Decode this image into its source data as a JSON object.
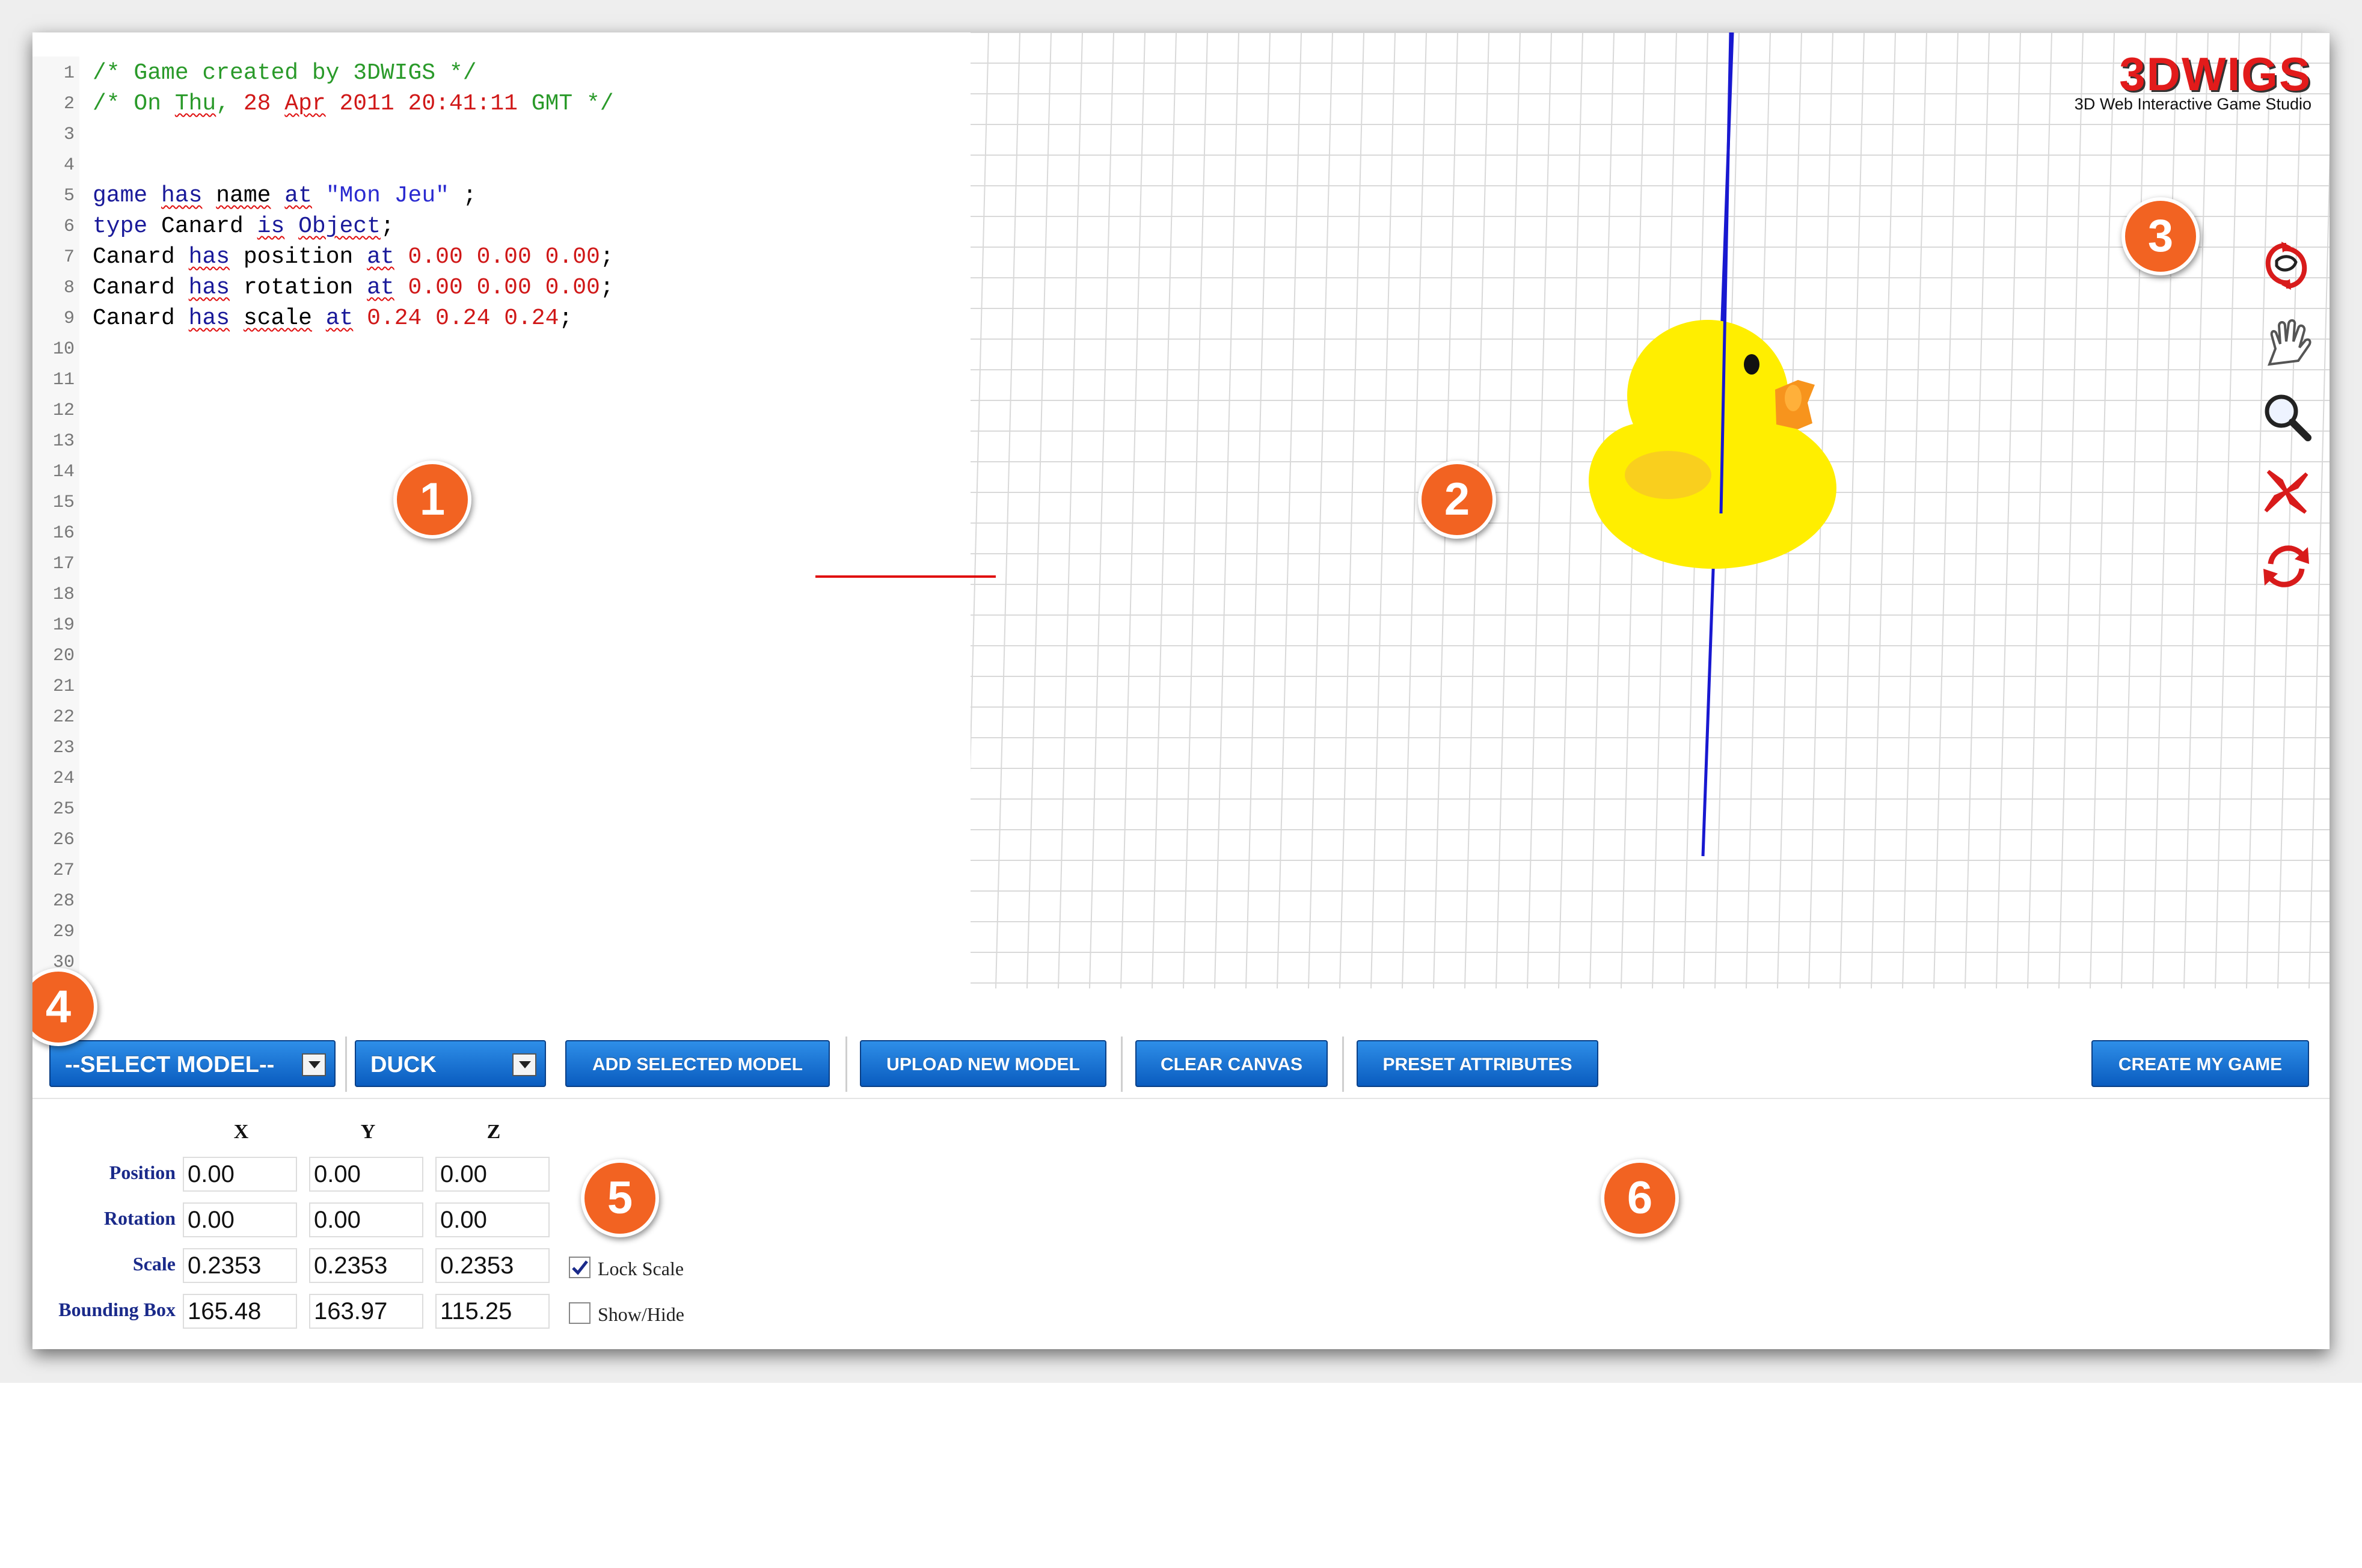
{
  "app": {
    "logo_text": "3DWIGS",
    "logo_tagline": "3D Web Interactive Game Studio"
  },
  "editor": {
    "line_numbers": [
      "1",
      "2",
      "3",
      "4",
      "5",
      "6",
      "7",
      "8",
      "9",
      "10",
      "11",
      "12",
      "13",
      "14",
      "15",
      "16",
      "17",
      "18",
      "19",
      "20",
      "21",
      "22",
      "23",
      "24",
      "25",
      "26",
      "27",
      "28",
      "29",
      "30"
    ],
    "lines": [
      "/* Game created by 3DWIGS */",
      "/* On Thu, 28 Apr 2011 20:41:11 GMT */",
      "",
      "",
      "game has name at \"Mon Jeu\" ;",
      "type Canard is Object;",
      "Canard has position at 0.00 0.00 0.00;",
      "Canard has rotation at 0.00 0.00 0.00;",
      "Canard has scale at 0.24 0.24 0.24;"
    ],
    "colors": {
      "comment": "#2a9a2a",
      "keyword": "#1a1a9a",
      "number": "#d01818",
      "string": "#2a2ad0",
      "date": "#d01818"
    }
  },
  "viewport": {
    "model": "duck",
    "colors": {
      "grid": "#d9d9d9",
      "x_axis": "#e01010",
      "y_axis": "#1818d0",
      "duck_body": "#ffee00",
      "duck_beak": "#f7941d"
    }
  },
  "view_tools": [
    {
      "name": "rotate-view-icon"
    },
    {
      "name": "pan-hand-icon"
    },
    {
      "name": "zoom-magnifier-icon"
    },
    {
      "name": "fit-view-icon"
    },
    {
      "name": "reset-view-icon"
    }
  ],
  "badges": [
    "1",
    "2",
    "3",
    "4",
    "5",
    "6"
  ],
  "toolbar": {
    "select_model": "--SELECT MODEL--",
    "model_choice": "DUCK",
    "add_selected_model": "ADD SELECTED MODEL",
    "upload_new_model": "UPLOAD NEW MODEL",
    "clear_canvas": "CLEAR CANVAS",
    "preset_attributes": "PRESET ATTRIBUTES",
    "create_my_game": "CREATE MY GAME",
    "button_color": "#1a73d6"
  },
  "attributes": {
    "headers": [
      "X",
      "Y",
      "Z"
    ],
    "rows": [
      {
        "label": "Position",
        "x": "0.00",
        "y": "0.00",
        "z": "0.00"
      },
      {
        "label": "Rotation",
        "x": "0.00",
        "y": "0.00",
        "z": "0.00"
      },
      {
        "label": "Scale",
        "x": "0.2353",
        "y": "0.2353",
        "z": "0.2353"
      },
      {
        "label": "Bounding Box",
        "x": "165.48",
        "y": "163.97",
        "z": "115.25"
      }
    ],
    "lock_scale": {
      "label": "Lock Scale",
      "checked": true
    },
    "show_hide": {
      "label": "Show/Hide",
      "checked": false
    }
  }
}
